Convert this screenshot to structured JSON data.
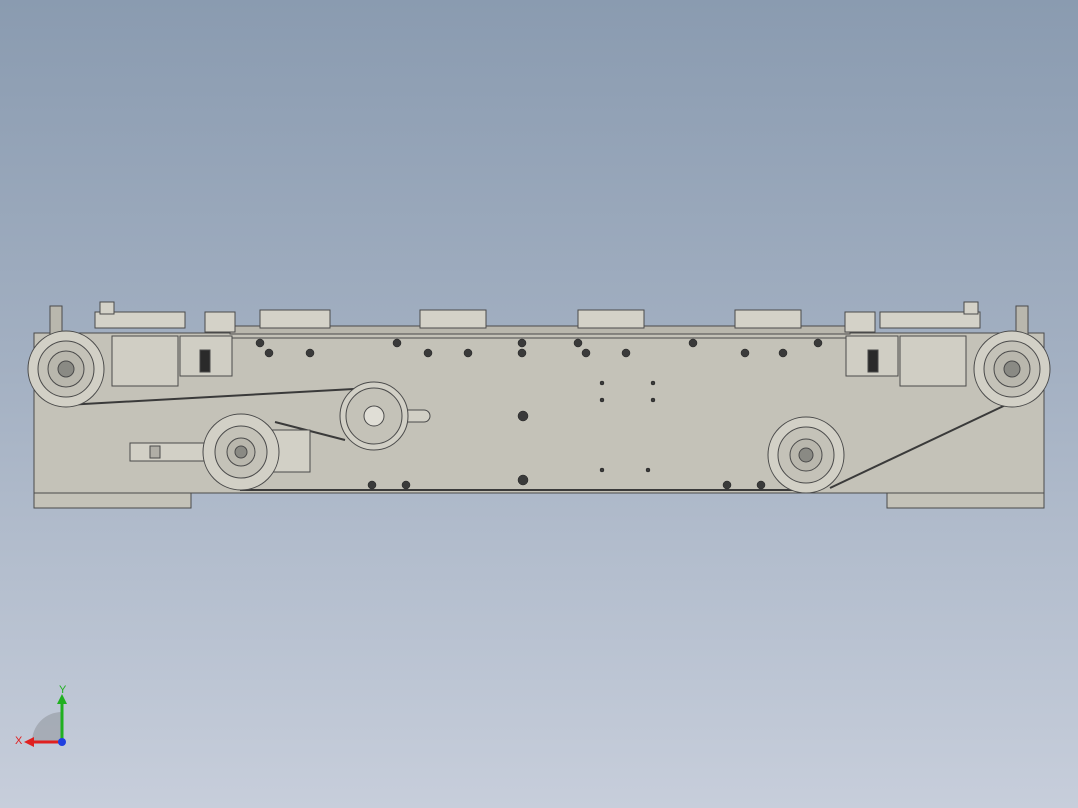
{
  "viewport": {
    "background_top": "#8a9bb0",
    "background_bottom": "#c7cedb"
  },
  "model": {
    "body_color": "#c4c2b8",
    "edge_color": "#4a4a4a",
    "bolt_color": "#3a3a3a"
  },
  "triad": {
    "x_label": "X",
    "y_label": "Y",
    "x_color": "#e02020",
    "y_color": "#20b020",
    "z_color": "#2040e0"
  }
}
